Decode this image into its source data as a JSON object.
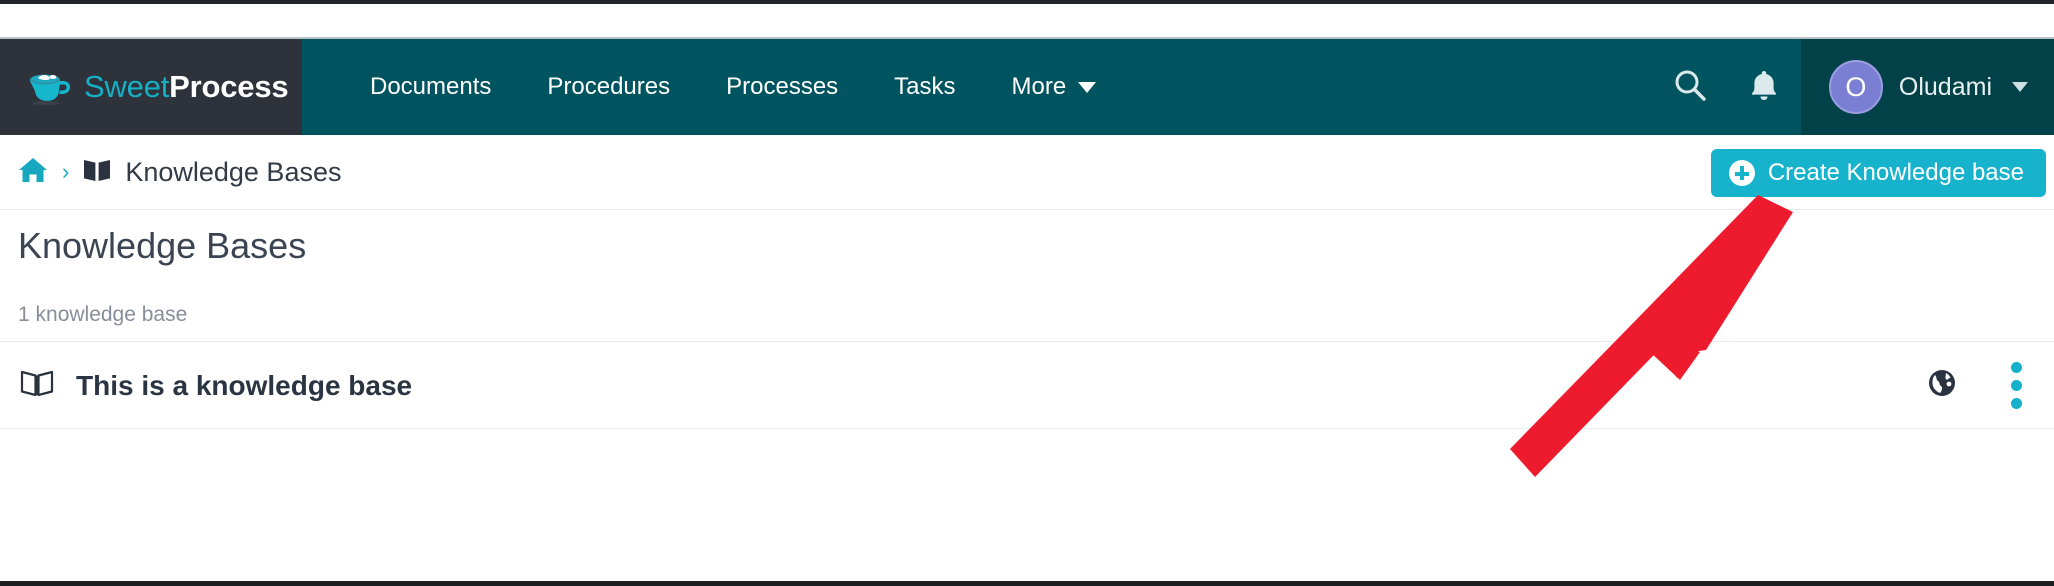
{
  "brand": {
    "name_part1": "Sweet",
    "name_part2": "Process",
    "logo_icon": "coffee-cup-icon",
    "teal": "#14b0c4",
    "bar_color": "#2d323b"
  },
  "nav": {
    "background": "#005460",
    "items": [
      {
        "label": "Documents"
      },
      {
        "label": "Procedures"
      },
      {
        "label": "Processes"
      },
      {
        "label": "Tasks"
      },
      {
        "label": "More",
        "has_caret": true
      }
    ],
    "search_icon": "search-icon",
    "notifications_icon": "bell-icon",
    "user": {
      "avatar_initial": "O",
      "avatar_color": "#7b7fd4",
      "name": "Oludami",
      "has_caret": true
    }
  },
  "breadcrumb": {
    "home_icon": "home-icon",
    "separator": "›",
    "book_icon": "book-icon",
    "current": "Knowledge Bases"
  },
  "actions": {
    "create_label": "Create Knowledge base",
    "create_icon": "plus-circle-icon",
    "create_color": "#17b3cd"
  },
  "main": {
    "title": "Knowledge Bases",
    "count_text": "1 knowledge base",
    "items": [
      {
        "icon": "open-book-icon",
        "name": "This is a knowledge base",
        "visibility_icon": "globe-icon",
        "menu_icon": "kebab-menu-icon"
      }
    ]
  },
  "annotation": {
    "type": "arrow",
    "color": "#ee1b2e",
    "points_to": "Create Knowledge base"
  }
}
